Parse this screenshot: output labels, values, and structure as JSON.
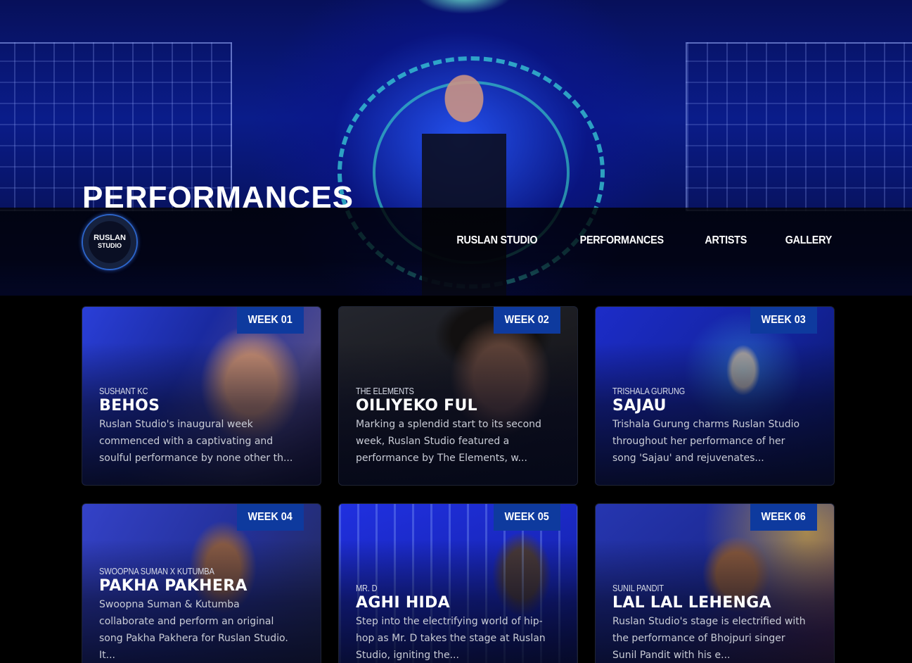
{
  "hero": {
    "title": "PERFORMANCES"
  },
  "logo": {
    "line1": "RUSLAN",
    "line2": "STUDIO"
  },
  "nav": {
    "items": [
      "RUSLAN STUDIO",
      "PERFORMANCES",
      "ARTISTS",
      "GALLERY"
    ]
  },
  "cards": [
    {
      "week": "WEEK 01",
      "artist": "SUSHANT KC",
      "title": "BEHOS",
      "desc": "Ruslan Studio's inaugural week commenced with a captivating and soulful performance by none other th..."
    },
    {
      "week": "WEEK 02",
      "artist": "THE ELEMENTS",
      "title": "OILIYEKO FUL",
      "desc": "Marking a splendid start to its second week, Ruslan Studio featured a performance by The Elements, w..."
    },
    {
      "week": "WEEK 03",
      "artist": "TRISHALA GURUNG",
      "title": "SAJAU",
      "desc": "Trishala Gurung charms Ruslan Studio throughout her performance of her song 'Sajau' and rejuvenates..."
    },
    {
      "week": "WEEK 04",
      "artist": "SWOOPNA SUMAN X KUTUMBA",
      "title": "PAKHA PAKHERA",
      "desc": "Swoopna Suman & Kutumba collaborate and perform an original song Pakha Pakhera for Ruslan Studio. It..."
    },
    {
      "week": "WEEK 05",
      "artist": "MR. D",
      "title": "AGHI HIDA",
      "desc": "Step into the electrifying world of hip-hop as Mr. D takes the stage at Ruslan Studio, igniting the..."
    },
    {
      "week": "WEEK 06",
      "artist": "SUNIL PANDIT",
      "title": "LAL LAL LEHENGA",
      "desc": "Ruslan Studio's stage is electrified with the performance of Bhojpuri singer Sunil Pandit with his e..."
    }
  ]
}
